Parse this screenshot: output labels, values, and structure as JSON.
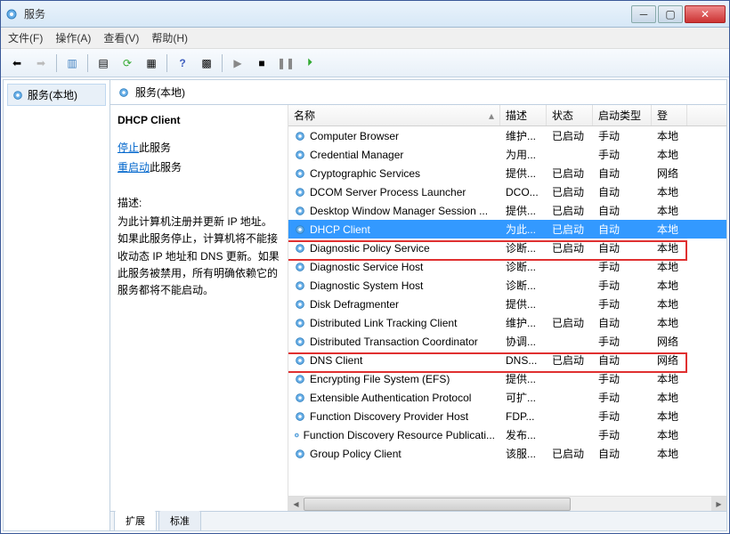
{
  "window": {
    "title": "服务"
  },
  "menu": {
    "file": "文件(F)",
    "action": "操作(A)",
    "view": "查看(V)",
    "help": "帮助(H)"
  },
  "tree": {
    "root": "服务(本地)"
  },
  "content": {
    "header": "服务(本地)"
  },
  "detail": {
    "title": "DHCP Client",
    "stop_link": "停止",
    "stop_suffix": "此服务",
    "restart_link": "重启动",
    "restart_suffix": "此服务",
    "desc_label": "描述:",
    "desc": "为此计算机注册并更新 IP 地址。如果此服务停止，计算机将不能接收动态 IP 地址和 DNS 更新。如果此服务被禁用，所有明确依赖它的服务都将不能启动。"
  },
  "columns": {
    "name": "名称",
    "desc": "描述",
    "status": "状态",
    "startup": "启动类型",
    "logon": "登"
  },
  "services": [
    {
      "name": "Computer Browser",
      "desc": "维护...",
      "status": "已启动",
      "startup": "手动",
      "logon": "本地"
    },
    {
      "name": "Credential Manager",
      "desc": "为用...",
      "status": "",
      "startup": "手动",
      "logon": "本地"
    },
    {
      "name": "Cryptographic Services",
      "desc": "提供...",
      "status": "已启动",
      "startup": "自动",
      "logon": "网络"
    },
    {
      "name": "DCOM Server Process Launcher",
      "desc": "DCO...",
      "status": "已启动",
      "startup": "自动",
      "logon": "本地"
    },
    {
      "name": "Desktop Window Manager Session ...",
      "desc": "提供...",
      "status": "已启动",
      "startup": "自动",
      "logon": "本地"
    },
    {
      "name": "DHCP Client",
      "desc": "为此...",
      "status": "已启动",
      "startup": "自动",
      "logon": "本地"
    },
    {
      "name": "Diagnostic Policy Service",
      "desc": "诊断...",
      "status": "已启动",
      "startup": "自动",
      "logon": "本地"
    },
    {
      "name": "Diagnostic Service Host",
      "desc": "诊断...",
      "status": "",
      "startup": "手动",
      "logon": "本地"
    },
    {
      "name": "Diagnostic System Host",
      "desc": "诊断...",
      "status": "",
      "startup": "手动",
      "logon": "本地"
    },
    {
      "name": "Disk Defragmenter",
      "desc": "提供...",
      "status": "",
      "startup": "手动",
      "logon": "本地"
    },
    {
      "name": "Distributed Link Tracking Client",
      "desc": "维护...",
      "status": "已启动",
      "startup": "自动",
      "logon": "本地"
    },
    {
      "name": "Distributed Transaction Coordinator",
      "desc": "协调...",
      "status": "",
      "startup": "手动",
      "logon": "网络"
    },
    {
      "name": "DNS Client",
      "desc": "DNS...",
      "status": "已启动",
      "startup": "自动",
      "logon": "网络"
    },
    {
      "name": "Encrypting File System (EFS)",
      "desc": "提供...",
      "status": "",
      "startup": "手动",
      "logon": "本地"
    },
    {
      "name": "Extensible Authentication Protocol",
      "desc": "可扩...",
      "status": "",
      "startup": "手动",
      "logon": "本地"
    },
    {
      "name": "Function Discovery Provider Host",
      "desc": "FDP...",
      "status": "",
      "startup": "手动",
      "logon": "本地"
    },
    {
      "name": "Function Discovery Resource Publicati...",
      "desc": "发布...",
      "status": "",
      "startup": "手动",
      "logon": "本地"
    },
    {
      "name": "Group Policy Client",
      "desc": "该服...",
      "status": "已启动",
      "startup": "自动",
      "logon": "本地"
    }
  ],
  "selected_index": 5,
  "tabs": {
    "extended": "扩展",
    "standard": "标准"
  }
}
